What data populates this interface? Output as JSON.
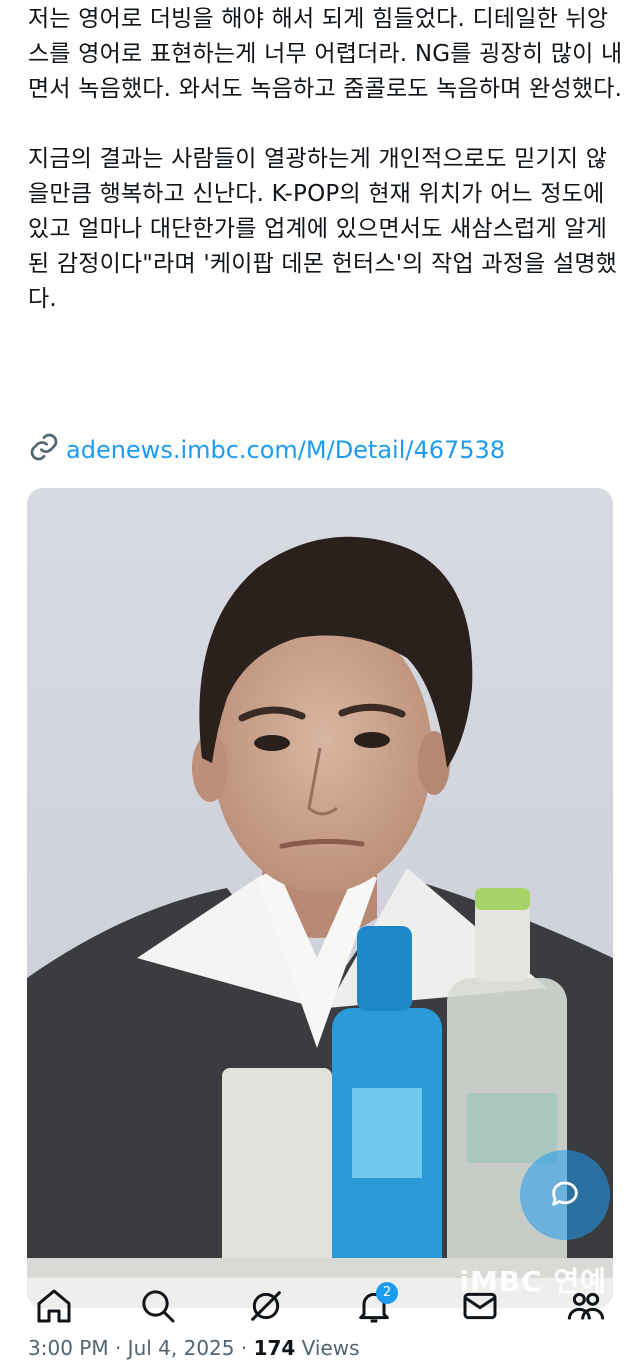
{
  "post": {
    "paragraph1": "저는 영어로 더빙을 해야 해서 되게 힘들었다. 디테일한 뉘앙스를 영어로 표현하는게 너무 어렵더라. NG를 굉장히 많이 내면서 녹음했다. 와서도 녹음하고 줌콜로도 녹음하며 완성했다.",
    "paragraph2": "지금의 결과는 사람들이 열광하는게 개인적으로도 믿기지 않을만큼 행복하고 신난다. K-POP의 현재 위치가 어느 정도에 있고 얼마나 대단한가를 업계에 있으면서도 새삼스럽게 알게 된 감정이다\"라며 '케이팝 데몬 헌터스'의 작업 과정을 설명했다.",
    "link_text": "adenews.imbc.com/M/Detail/467538",
    "link_icon": "link-icon",
    "image_watermark": "iMBC 연예"
  },
  "tabbar": {
    "tabs": [
      {
        "name": "home",
        "icon": "home-icon"
      },
      {
        "name": "search",
        "icon": "search-icon"
      },
      {
        "name": "grok",
        "icon": "grok-icon"
      },
      {
        "name": "notifications",
        "icon": "bell-icon",
        "badge": "2"
      },
      {
        "name": "messages",
        "icon": "mail-icon"
      },
      {
        "name": "communities",
        "icon": "people-icon"
      }
    ]
  },
  "meta": {
    "time": "3:00 PM",
    "sep1": " · ",
    "date": "Jul 4, 2025",
    "sep2": " · ",
    "views_count": "174",
    "views_label": " Views"
  },
  "colors": {
    "accent": "#1d9bf0",
    "text": "#0f1419",
    "secondary": "#536471"
  }
}
